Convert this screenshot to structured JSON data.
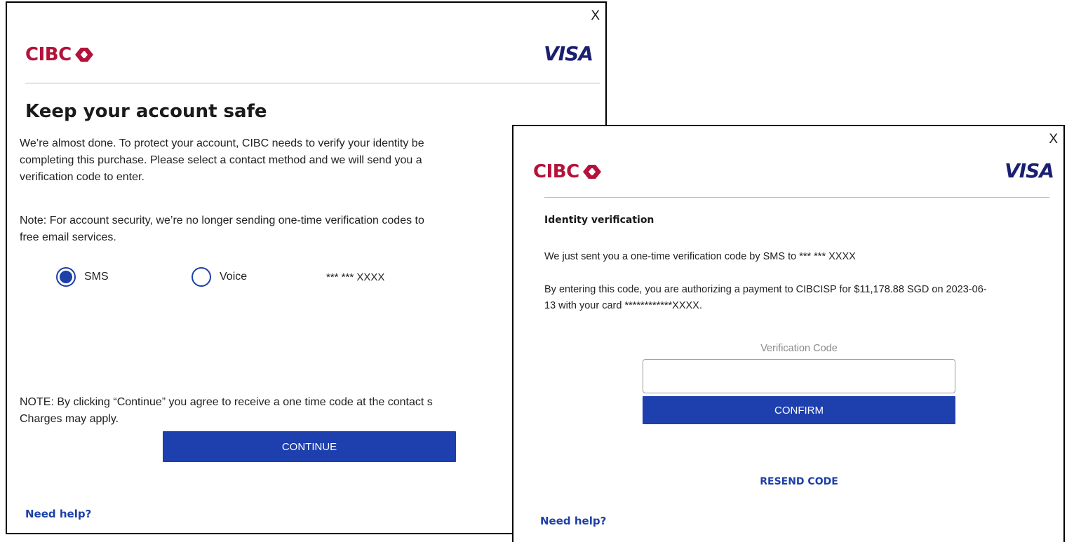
{
  "colors": {
    "cibc_red": "#b5123a",
    "visa_blue": "#1a1f71",
    "button_blue": "#1e3fae",
    "link_blue": "#1c3fa8"
  },
  "contact_dialog": {
    "close_label": "X",
    "logo_cibc": "CIBC",
    "logo_visa": "VISA",
    "title": "Keep your account safe",
    "intro_lines": [
      "We’re almost done. To protect your account, CIBC needs to verify your identity be",
      "completing this purchase. Please select a contact method and we will send you a",
      "verification code to enter."
    ],
    "note_lines": [
      "Note: For account security, we’re no longer sending one-time verification codes to",
      "free email services."
    ],
    "methods": [
      {
        "label": "SMS",
        "selected": true
      },
      {
        "label": "Voice",
        "selected": false
      }
    ],
    "contact_mask": "*** *** XXXX",
    "agree_lines": [
      "NOTE: By clicking “Continue” you agree to receive a one time code at the contact s",
      "Charges may apply."
    ],
    "continue_label": "CONTINUE",
    "help_label": "Need help?"
  },
  "verify_dialog": {
    "close_label": "X",
    "logo_cibc": "CIBC",
    "logo_visa": "VISA",
    "title": "Identity verification",
    "sent_text": "We just sent you a one-time verification code by SMS to *** *** XXXX",
    "auth_lines": [
      "By entering this code, you are authorizing a payment to CIBCISP for  $11,178.88 SGD on 2023-06-",
      "13 with your card ************XXXX."
    ],
    "code_label": "Verification Code",
    "code_value": "",
    "confirm_label": "CONFIRM",
    "resend_label": "RESEND CODE",
    "help_label": "Need help?"
  }
}
